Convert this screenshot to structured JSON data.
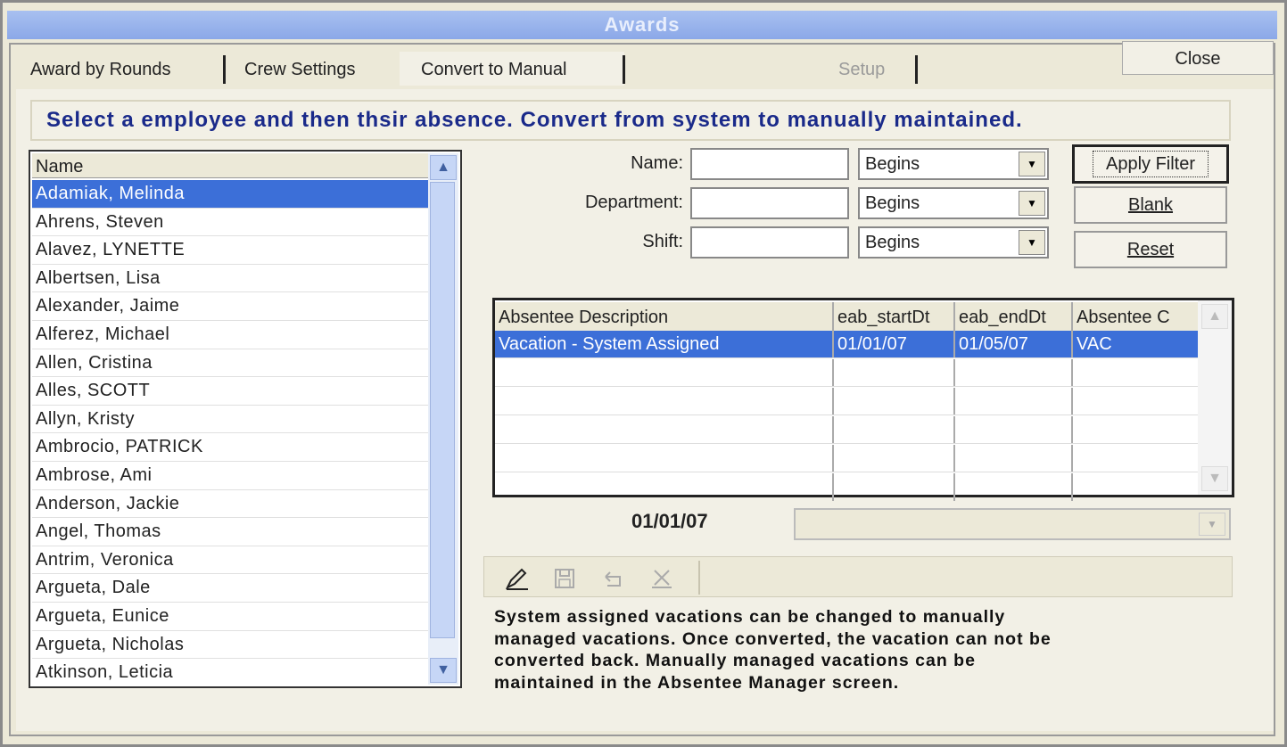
{
  "window": {
    "title": "Awards"
  },
  "tabs": [
    {
      "label": "Award by Rounds"
    },
    {
      "label": "Crew Settings"
    },
    {
      "label": "Convert to Manual"
    },
    {
      "label": "Setup"
    }
  ],
  "close_label": "Close",
  "instruction": "Select a employee and then thsir absence.  Convert from system to manually maintained.",
  "name_list": {
    "header": "Name",
    "items": [
      "Adamiak, Melinda",
      "Ahrens, Steven",
      "Alavez, LYNETTE",
      "Albertsen, Lisa",
      "Alexander, Jaime",
      "Alferez, Michael",
      "Allen, Cristina",
      "Alles, SCOTT",
      "Allyn, Kristy",
      "Ambrocio, PATRICK",
      "Ambrose, Ami",
      "Anderson, Jackie",
      "Angel, Thomas",
      "Antrim, Veronica",
      "Argueta, Dale",
      "Argueta, Eunice",
      "Argueta, Nicholas",
      "Atkinson, Leticia"
    ]
  },
  "filters": {
    "name_label": "Name:",
    "department_label": "Department:",
    "shift_label": "Shift:",
    "name_mode": "Begins",
    "department_mode": "Begins",
    "shift_mode": "Begins"
  },
  "buttons": {
    "apply_filter": "Apply Filter",
    "blank": "Blank",
    "reset": "Reset"
  },
  "absence_grid": {
    "columns": [
      "Absentee Description",
      "eab_startDt",
      "eab_endDt",
      "Absentee  C"
    ],
    "rows": [
      [
        "Vacation - System Assigned",
        "01/01/07",
        "01/05/07",
        "VAC"
      ]
    ]
  },
  "selected_date": "01/01/07",
  "toolbar_icons": [
    "pencil-icon",
    "save-icon",
    "undo-icon",
    "delete-icon"
  ],
  "note_lines": [
    "System assigned vacations can be changed to manually",
    "managed vacations.  Once converted, the vacation can not be",
    "converted back.  Manually managed vacations can be",
    "maintained in the Absentee Manager screen."
  ]
}
